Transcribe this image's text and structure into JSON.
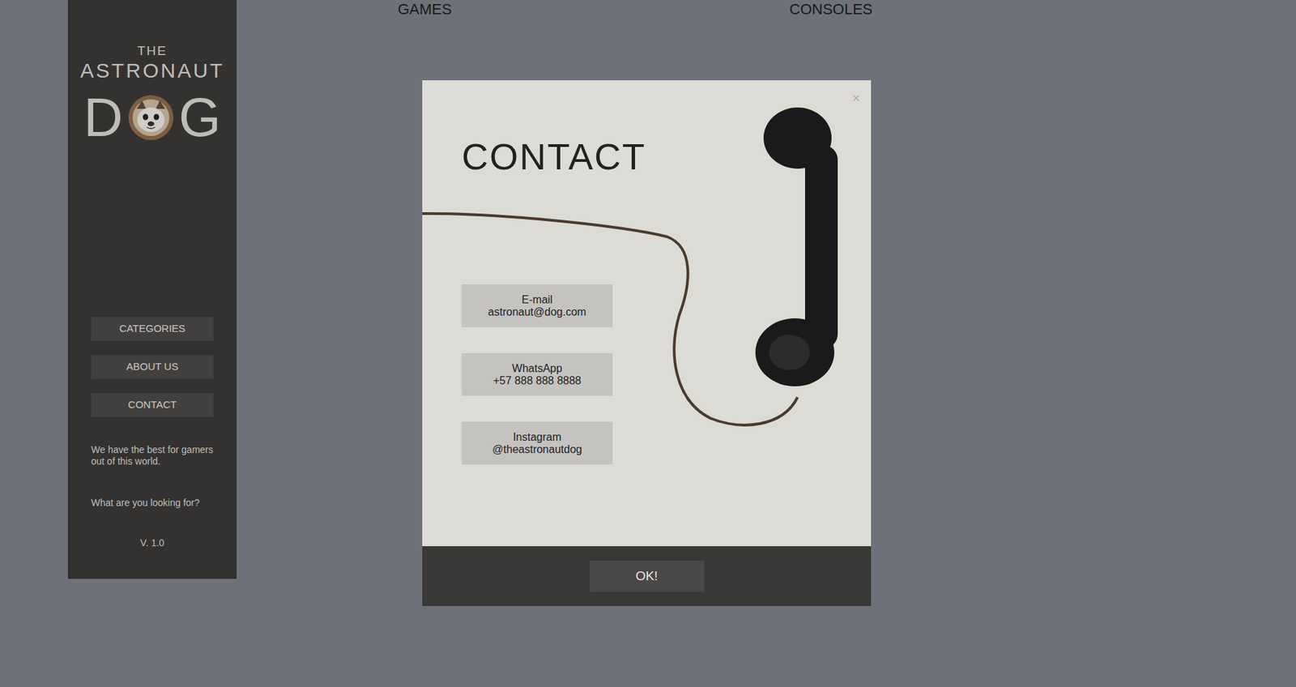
{
  "nav": {
    "items": [
      "GAMES",
      "CONSOLES"
    ]
  },
  "sidebar": {
    "logo": {
      "line1": "THE",
      "line2": "ASTRONAUT",
      "letters": [
        "D",
        "G"
      ]
    },
    "menu": [
      {
        "label": "CATEGORIES",
        "selected": false
      },
      {
        "label": "ABOUT US",
        "selected": false
      },
      {
        "label": "CONTACT",
        "selected": false
      }
    ],
    "tagline": "We have the best for gamers out of this world.",
    "prompt": "What are you looking for?",
    "version": "V. 1.0"
  },
  "dialog": {
    "title": "CONTACT",
    "close": "×",
    "contacts": [
      {
        "label": "E-mail",
        "value": "astronaut@dog.com"
      },
      {
        "label": "WhatsApp",
        "value": "+57 888 888 8888"
      },
      {
        "label": "Instagram",
        "value": "@theastronautdog"
      }
    ],
    "buttons": [
      "OK!"
    ]
  }
}
